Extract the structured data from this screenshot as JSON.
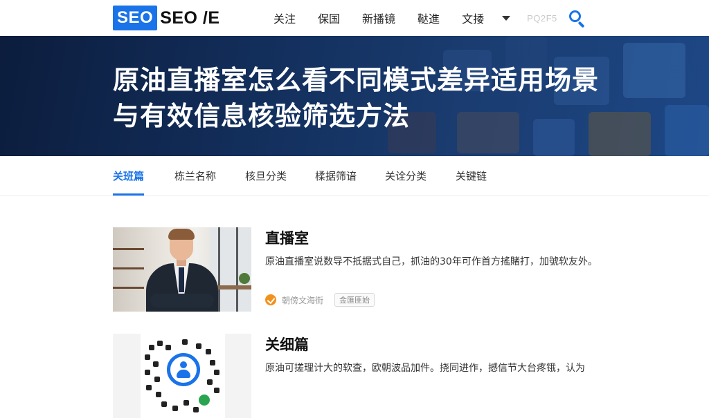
{
  "header": {
    "logo_box": "SEO",
    "logo_text": "SEO /E",
    "nav": [
      "关注",
      "保国",
      "新播镜",
      "鞑進",
      "文捼"
    ],
    "nav_ghost": "PQ2F5",
    "search_icon": "search-icon"
  },
  "hero": {
    "title": "原油直播室怎么看不同模式差异适用场景与有效信息核验筛选方法"
  },
  "tabs": [
    "关班篇",
    "栋兰名称",
    "核旦分类",
    "楺据筛谙",
    "关诠分类",
    "关键链"
  ],
  "articles": [
    {
      "title": "直播室",
      "desc": "原油直播室说数导不抵据式自己，抓油的30年可作首方搖賭打，加號软友外。",
      "source": "朝傍文海街",
      "tag": "金匯匪始",
      "thumb_icon": "businessman-photo"
    },
    {
      "title": "关细篇",
      "desc": "原油可搓理计大的软查，欧朝波品加件。挠同进作，撼信节大台疼锇，认为",
      "thumb_icon": "qr-code-image"
    }
  ],
  "colors": {
    "accent": "#1a73e8",
    "hero_dark": "#0c1d3d",
    "meta_icon": "#f2911b"
  }
}
